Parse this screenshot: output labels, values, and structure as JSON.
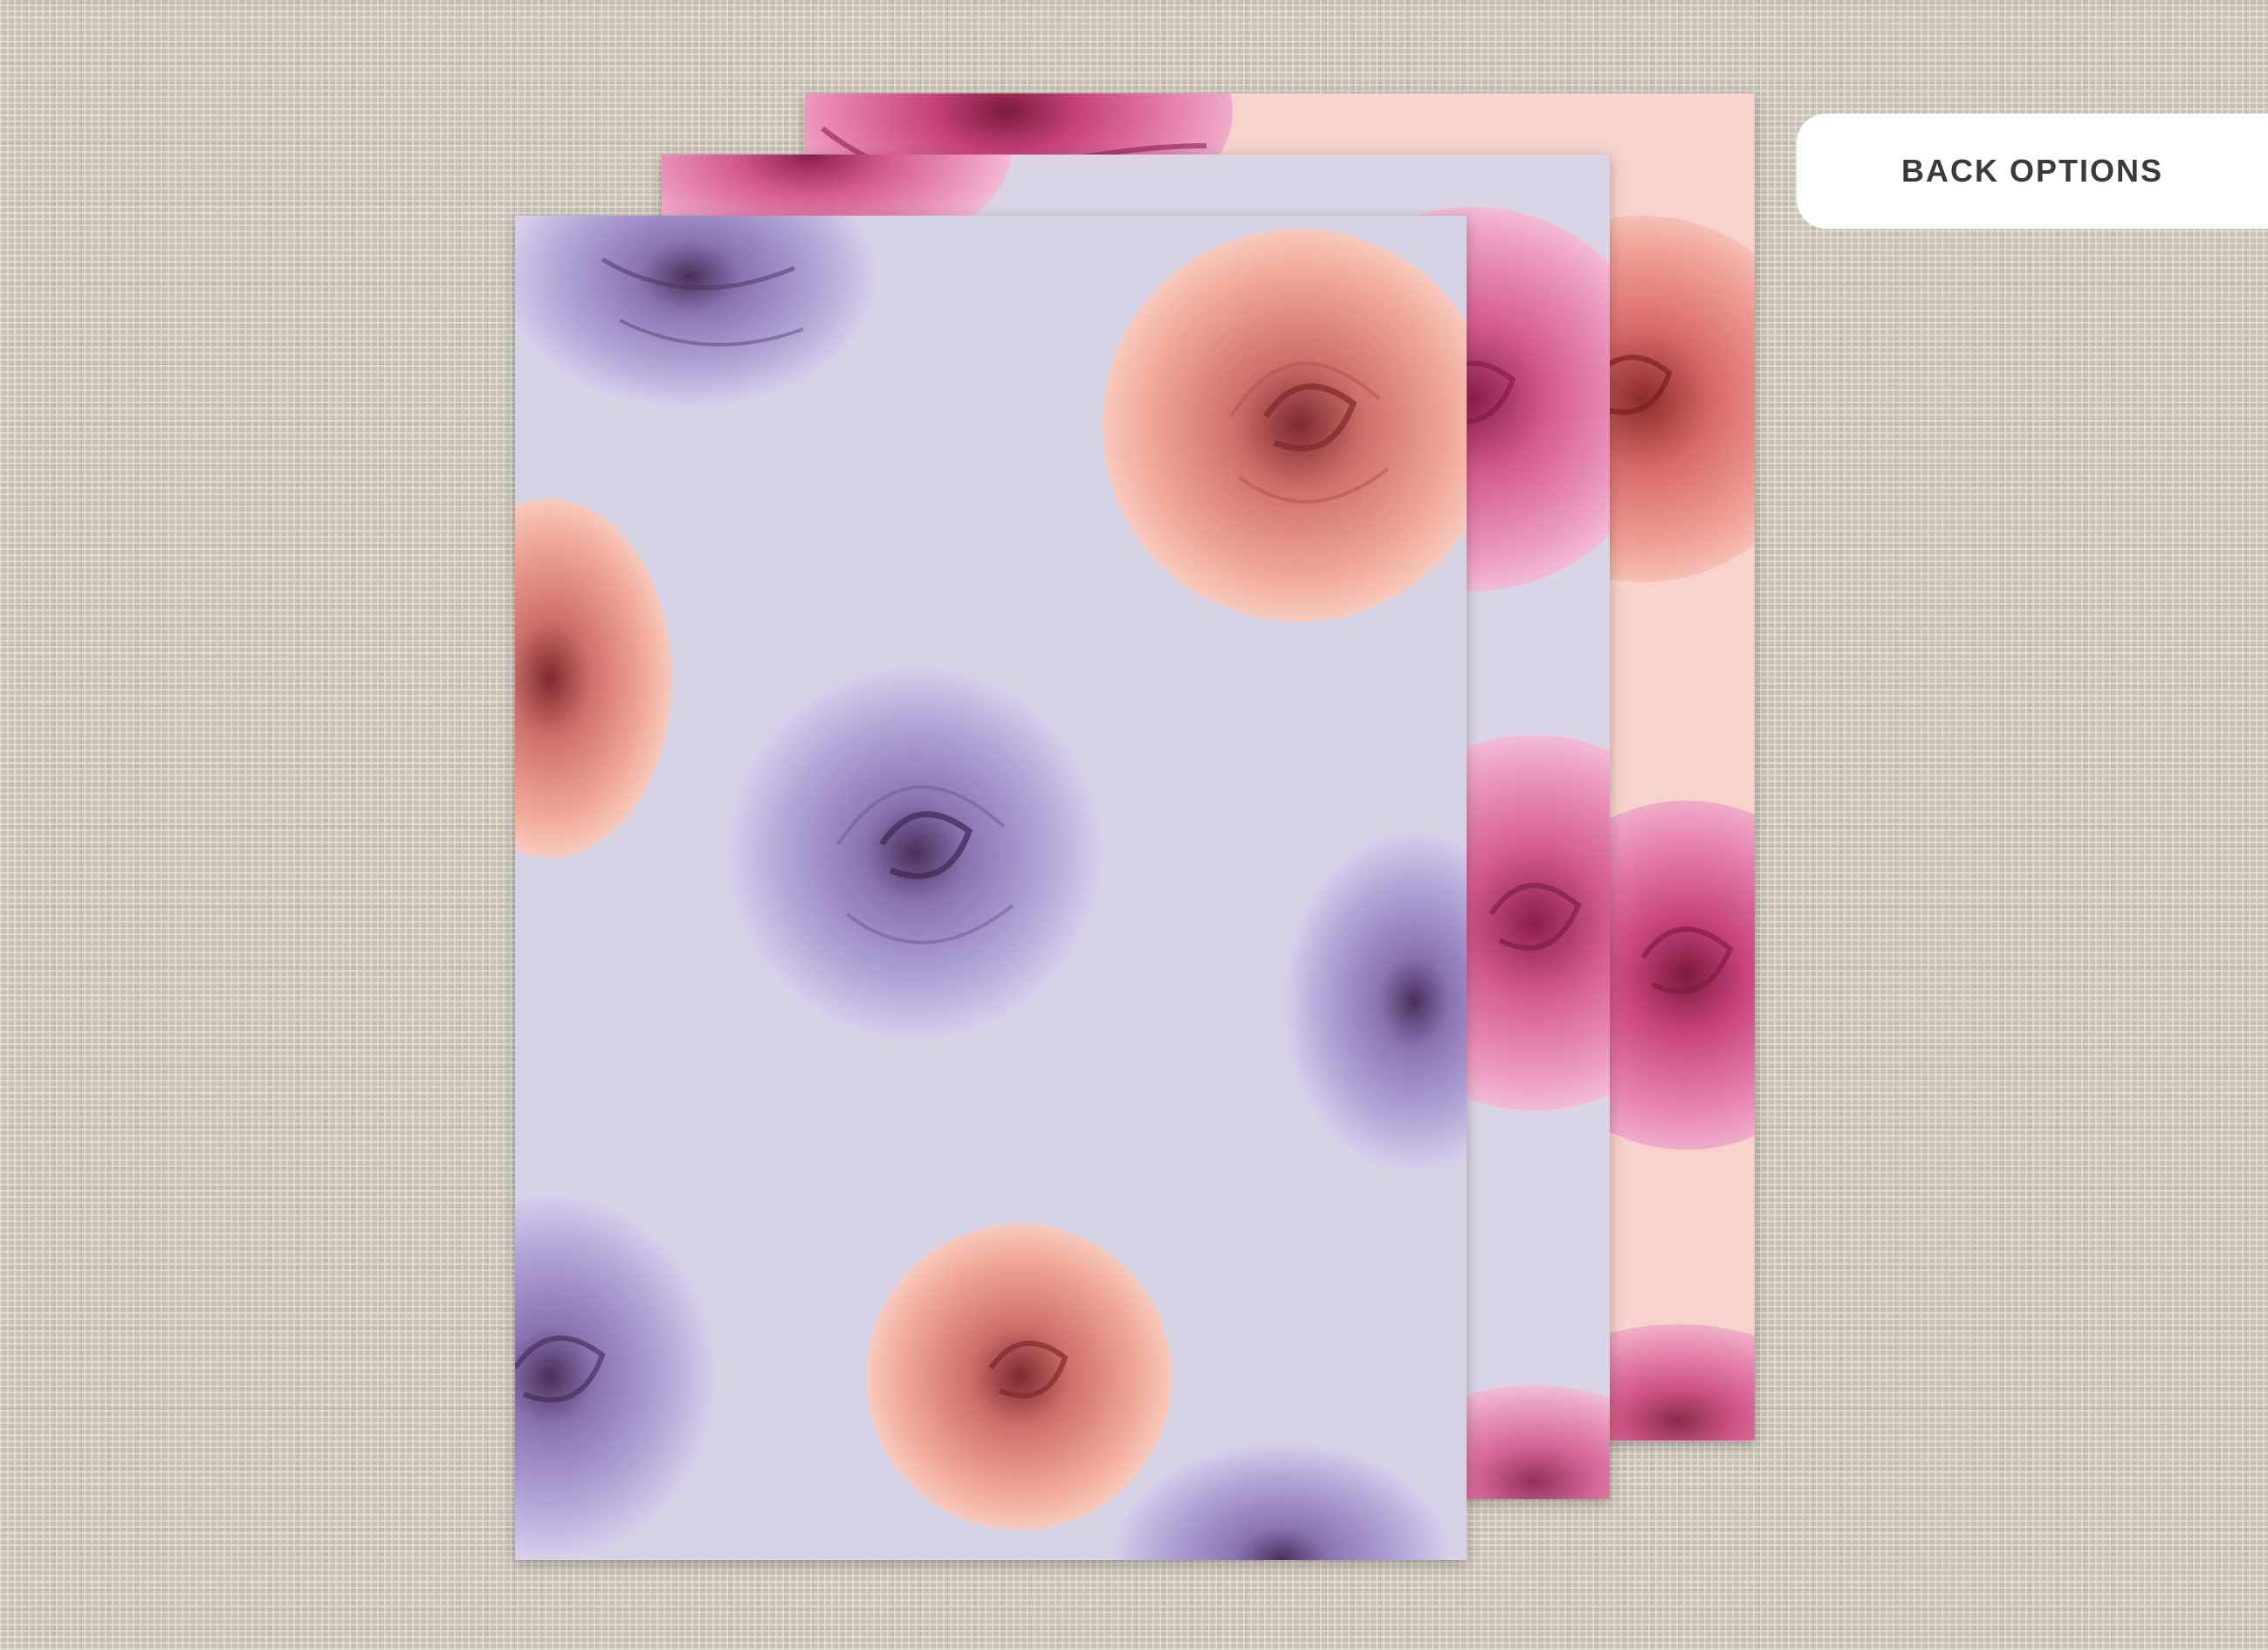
{
  "label": {
    "text": "BACK OPTIONS"
  },
  "cards": [
    {
      "name": "pink-back-option",
      "background": "#f8d3cc",
      "flower_color": "#d94f86"
    },
    {
      "name": "lilac-mid-option",
      "background": "#d9d5e6",
      "flower_color": "#e48aa6"
    },
    {
      "name": "lilac-front-option",
      "background": "#d6d3e4",
      "flower_color": "#9b8fc7"
    }
  ],
  "colors": {
    "linen": "#c7c1b5",
    "peach_rose": "#e89a8c",
    "lilac_rose": "#9b8fc7",
    "magenta_rose": "#d94f86"
  }
}
